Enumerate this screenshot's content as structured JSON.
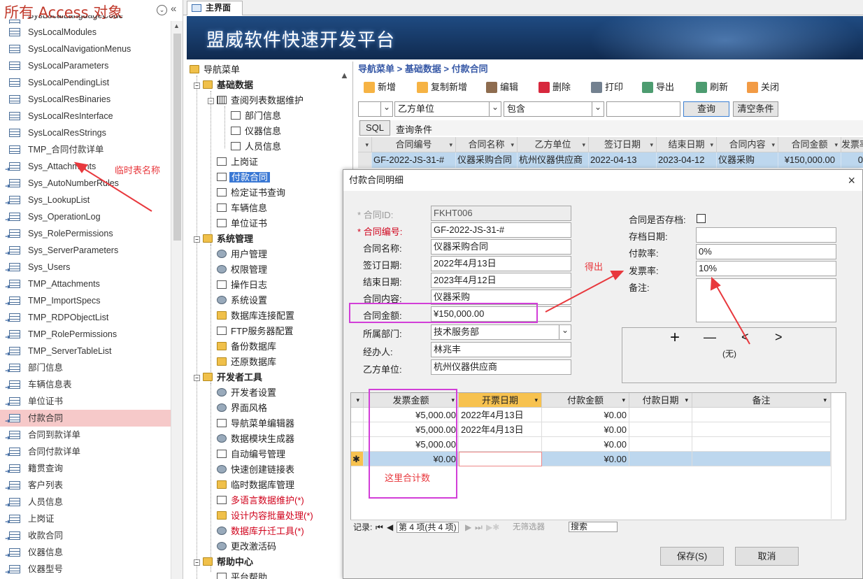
{
  "nav_pane": {
    "title": "所有 Access 对象",
    "collapse": "«",
    "dropdown": "⌄",
    "items": [
      {
        "label": "SysLocalLanguageCode",
        "linked": false
      },
      {
        "label": "SysLocalModules",
        "linked": false
      },
      {
        "label": "SysLocalNavigationMenus",
        "linked": false
      },
      {
        "label": "SysLocalParameters",
        "linked": false
      },
      {
        "label": "SysLocalPendingList",
        "linked": false
      },
      {
        "label": "SysLocalResBinaries",
        "linked": false
      },
      {
        "label": "SysLocalResInterface",
        "linked": false
      },
      {
        "label": "SysLocalResStrings",
        "linked": false
      },
      {
        "label": "TMP_合同付款详单",
        "linked": false
      },
      {
        "label": "Sys_Attachments",
        "linked": true
      },
      {
        "label": "Sys_AutoNumberRules",
        "linked": true
      },
      {
        "label": "Sys_LookupList",
        "linked": true
      },
      {
        "label": "Sys_OperationLog",
        "linked": true
      },
      {
        "label": "Sys_RolePermissions",
        "linked": true
      },
      {
        "label": "Sys_ServerParameters",
        "linked": true
      },
      {
        "label": "Sys_Users",
        "linked": true
      },
      {
        "label": "TMP_Attachments",
        "linked": true
      },
      {
        "label": "TMP_ImportSpecs",
        "linked": true
      },
      {
        "label": "TMP_RDPObjectList",
        "linked": true
      },
      {
        "label": "TMP_RolePermissions",
        "linked": true
      },
      {
        "label": "TMP_ServerTableList",
        "linked": true
      },
      {
        "label": "部门信息",
        "linked": true
      },
      {
        "label": "车辆信息表",
        "linked": true
      },
      {
        "label": "单位证书",
        "linked": true
      },
      {
        "label": "付款合同",
        "linked": true,
        "selected": true
      },
      {
        "label": "合同到款详单",
        "linked": true
      },
      {
        "label": "合同付款详单",
        "linked": true
      },
      {
        "label": "籍贯查询",
        "linked": true
      },
      {
        "label": "客户列表",
        "linked": true
      },
      {
        "label": "人员信息",
        "linked": true
      },
      {
        "label": "上岗证",
        "linked": true
      },
      {
        "label": "收款合同",
        "linked": true
      },
      {
        "label": "仪器信息",
        "linked": true
      },
      {
        "label": "仪器型号",
        "linked": true
      }
    ]
  },
  "tab": {
    "label": "主界面"
  },
  "banner": {
    "title": "盟威软件快速开发平台"
  },
  "tree": [
    {
      "label": "导航菜单",
      "level": 0,
      "icon": "folder",
      "bold": false,
      "pm": ""
    },
    {
      "label": "基础数据",
      "level": 1,
      "icon": "folder",
      "bold": true,
      "pm": "−"
    },
    {
      "label": "查阅列表数据维护",
      "level": 2,
      "icon": "grid",
      "bold": false,
      "pm": "−"
    },
    {
      "label": "部门信息",
      "level": 3,
      "icon": "doc"
    },
    {
      "label": "仪器信息",
      "level": 3,
      "icon": "doc"
    },
    {
      "label": "人员信息",
      "level": 3,
      "icon": "doc"
    },
    {
      "label": "上岗证",
      "level": 2,
      "icon": "doc"
    },
    {
      "label": "付款合同",
      "level": 2,
      "icon": "doc",
      "selected": true
    },
    {
      "label": "检定证书查询",
      "level": 2,
      "icon": "doc"
    },
    {
      "label": "车辆信息",
      "level": 2,
      "icon": "doc"
    },
    {
      "label": "单位证书",
      "level": 2,
      "icon": "doc"
    },
    {
      "label": "系统管理",
      "level": 1,
      "icon": "folder",
      "bold": true,
      "pm": "−"
    },
    {
      "label": "用户管理",
      "level": 2,
      "icon": "gear"
    },
    {
      "label": "权限管理",
      "level": 2,
      "icon": "gear"
    },
    {
      "label": "操作日志",
      "level": 2,
      "icon": "doc"
    },
    {
      "label": "系统设置",
      "level": 2,
      "icon": "gear"
    },
    {
      "label": "数据库连接配置",
      "level": 2,
      "icon": "folder"
    },
    {
      "label": "FTP服务器配置",
      "level": 2,
      "icon": "doc"
    },
    {
      "label": "备份数据库",
      "level": 2,
      "icon": "folder"
    },
    {
      "label": "还原数据库",
      "level": 2,
      "icon": "folder"
    },
    {
      "label": "开发者工具",
      "level": 1,
      "icon": "folder",
      "bold": true,
      "pm": "−"
    },
    {
      "label": "开发者设置",
      "level": 2,
      "icon": "gear"
    },
    {
      "label": "界面风格",
      "level": 2,
      "icon": "gear"
    },
    {
      "label": "导航菜单编辑器",
      "level": 2,
      "icon": "doc"
    },
    {
      "label": "数据模块生成器",
      "level": 2,
      "icon": "gear"
    },
    {
      "label": "自动编号管理",
      "level": 2,
      "icon": "doc"
    },
    {
      "label": "快速创建链接表",
      "level": 2,
      "icon": "gear"
    },
    {
      "label": "临时数据库管理",
      "level": 2,
      "icon": "folder"
    },
    {
      "label": "多语言数据维护(*)",
      "level": 2,
      "icon": "doc",
      "red": true
    },
    {
      "label": "设计内容批量处理(*)",
      "level": 2,
      "icon": "folder",
      "red": true
    },
    {
      "label": "数据库升迁工具(*)",
      "level": 2,
      "icon": "gear",
      "red": true
    },
    {
      "label": "更改激活码",
      "level": 2,
      "icon": "gear"
    },
    {
      "label": "帮助中心",
      "level": 1,
      "icon": "folder",
      "bold": true,
      "pm": "−"
    },
    {
      "label": "平台帮助",
      "level": 2,
      "icon": "doc"
    }
  ],
  "breadcrumb": "导航菜单 > 基础数据 > 付款合同",
  "toolbar": [
    {
      "label": "新增",
      "icon": "new-icon",
      "color": "#f5a623"
    },
    {
      "label": "复制新增",
      "icon": "copy-icon",
      "color": "#f5a623"
    },
    {
      "label": "编辑",
      "icon": "edit-icon",
      "color": "#7a5230"
    },
    {
      "label": "删除",
      "icon": "delete-icon",
      "color": "#d0021b"
    },
    {
      "label": "打印",
      "icon": "print-icon",
      "color": "#5a6b7d"
    },
    {
      "label": "导出",
      "icon": "export-icon",
      "color": "#2e8b57"
    },
    {
      "label": "刷新",
      "icon": "refresh-icon",
      "color": "#2e8b57"
    },
    {
      "label": "关闭",
      "icon": "close-icon",
      "color": "#f08a24"
    }
  ],
  "filter": {
    "field1": "",
    "field2": "乙方单位",
    "op": "包含",
    "value": "",
    "query_btn": "查询",
    "clear_btn": "清空条件"
  },
  "sql": {
    "btn": "SQL",
    "text": "查询条件"
  },
  "list_grid": {
    "headers": [
      "合同编号",
      "合同名称",
      "乙方单位",
      "签订日期",
      "结束日期",
      "合同内容",
      "合同金额",
      "发票率"
    ],
    "row": [
      "GF-2022-JS-31-#",
      "仪器采购合同",
      "杭州仪器供应商",
      "2022-04-13",
      "2023-04-12",
      "仪器采购",
      "¥150,000.00",
      "0"
    ]
  },
  "dialog": {
    "title": "付款合同明细",
    "close": "×",
    "fields": {
      "id_label": "合同ID:",
      "id_value": "FKHT006",
      "no_label": "合同编号:",
      "no_value": "GF-2022-JS-31-#",
      "name_label": "合同名称:",
      "name_value": "仪器采购合同",
      "sign_label": "签订日期:",
      "sign_value": "2022年4月13日",
      "end_label": "结束日期:",
      "end_value": "2023年4月12日",
      "content_label": "合同内容:",
      "content_value": "仪器采购",
      "amount_label": "合同金额:",
      "amount_value": "¥150,000.00",
      "dept_label": "所属部门:",
      "dept_value": "技术服务部",
      "handler_label": "经办人:",
      "handler_value": "林兆丰",
      "partyb_label": "乙方单位:",
      "partyb_value": "杭州仪器供应商",
      "archived_label": "合同是否存档:",
      "archive_date_label": "存档日期:",
      "archive_date_value": "",
      "pay_rate_label": "付款率:",
      "pay_rate_value": "0%",
      "invoice_rate_label": "发票率:",
      "invoice_rate_value": "10%",
      "note_label": "备注:",
      "note_value": "",
      "required_mark": "*"
    },
    "attachment": {
      "add": "+",
      "remove": "—",
      "prev": "<",
      "next": ">",
      "empty": "(无)"
    },
    "subgrid": {
      "headers": [
        "发票金额",
        "开票日期",
        "付款金额",
        "付款日期",
        "备注"
      ],
      "rows": [
        [
          "¥5,000.00",
          "2022年4月13日",
          "¥0.00",
          "",
          ""
        ],
        [
          "¥5,000.00",
          "2022年4月13日",
          "¥0.00",
          "",
          ""
        ],
        [
          "¥5,000.00",
          "",
          "¥0.00",
          "",
          ""
        ],
        [
          "¥0.00",
          "",
          "¥0.00",
          "",
          ""
        ]
      ],
      "new_marker": "✱"
    },
    "recnav": {
      "label": "记录:",
      "first": "⏮",
      "prev": "◀",
      "pos": "第 4 项(共 4 项)",
      "next": "▶",
      "last": "⏭",
      "new": "▶✱",
      "nofilter": "无筛选器",
      "search": "搜索"
    },
    "save_btn": "保存(S)",
    "cancel_btn": "取消"
  },
  "annotations": {
    "temp_table": "临时表名称",
    "derived": "得出",
    "sum_here": "这里合计数"
  },
  "colors": {
    "annotation": "#e8383d",
    "highlight_box": "#d23ed8",
    "selection": "#bdd7ee",
    "nav_selected": "#f6c9c9"
  }
}
